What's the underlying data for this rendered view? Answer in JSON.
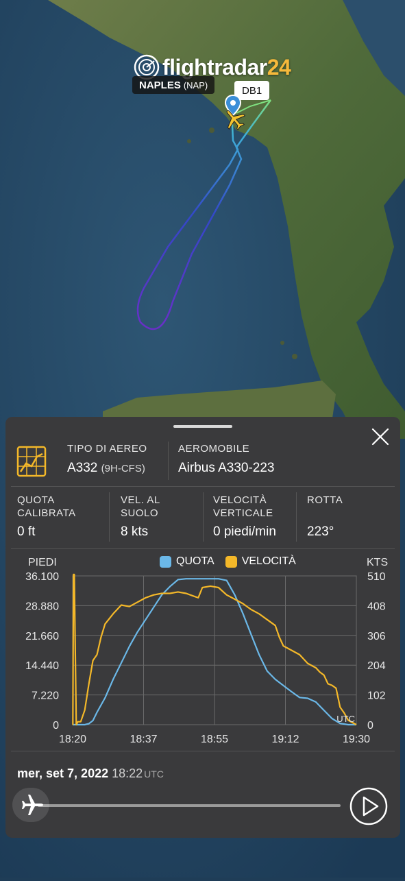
{
  "map": {
    "logo_text_main": "flightradar",
    "logo_text_accent": "24",
    "airport_name": "NAPLES",
    "airport_code": "(NAP)",
    "flight_label": "DB1"
  },
  "panel": {
    "aircraft_type_label": "TIPO DI AEREO",
    "aircraft_type_value": "A332",
    "aircraft_reg": "(9H-CFS)",
    "aircraft_label": "AEROMOBILE",
    "aircraft_value": "Airbus A330-223",
    "altitude_label": "QUOTA CALIBRATA",
    "altitude_value": "0 ft",
    "ground_speed_label": "VEL. AL SUOLO",
    "ground_speed_value": "8 kts",
    "vertical_speed_label": "VELOCITÀ VERTICALE",
    "vertical_speed_value": "0 piedi/min",
    "track_label": "ROTTA",
    "track_value": "223°",
    "date_text": "mer, set 7, 2022",
    "time_text": "18:22",
    "time_zone": "UTC"
  },
  "chart_data": {
    "type": "line",
    "left_axis_title": "PIEDI",
    "right_axis_title": "KTS",
    "utc_label": "UTC",
    "x_tick_labels": [
      "18:20",
      "18:37",
      "18:55",
      "19:12",
      "19:30"
    ],
    "y_left_tick_labels": [
      "0",
      "7.220",
      "14.440",
      "21.660",
      "28.880",
      "36.100"
    ],
    "y_right_tick_labels": [
      "0",
      "102",
      "204",
      "306",
      "408",
      "510"
    ],
    "ylim_left": [
      0,
      36100
    ],
    "ylim_right": [
      0,
      510
    ],
    "xlim_minutes": [
      0,
      70
    ],
    "grid": true,
    "cursor_minute": 0,
    "series": [
      {
        "name": "QUOTA",
        "color": "#6bb8e8",
        "axis": "left",
        "x": [
          0,
          2,
          3,
          4,
          5,
          6,
          8,
          10,
          12,
          14,
          16,
          18,
          20,
          22,
          24,
          26,
          28,
          30,
          32,
          34,
          36,
          38,
          40,
          42,
          44,
          46,
          48,
          50,
          52,
          54,
          56,
          58,
          60,
          62,
          64,
          66,
          68,
          70
        ],
        "y": [
          0,
          0,
          0,
          250,
          1000,
          3000,
          6500,
          11000,
          15000,
          19000,
          22500,
          25500,
          28500,
          31500,
          33500,
          35200,
          35400,
          35400,
          35400,
          35400,
          35400,
          35000,
          31500,
          27000,
          22000,
          17000,
          13000,
          11000,
          9500,
          8000,
          6600,
          6400,
          5500,
          3500,
          1500,
          300,
          0,
          0
        ]
      },
      {
        "name": "VELOCITÀ",
        "color": "#f4b829",
        "axis": "right",
        "x": [
          0,
          0.05,
          0.2,
          0.4,
          0.9,
          1.3,
          2,
          3,
          4,
          5,
          6,
          7,
          8,
          10,
          12,
          14,
          16,
          18,
          20,
          22,
          24,
          26,
          28,
          30,
          31,
          32,
          34,
          36,
          38,
          40,
          42,
          44,
          46,
          48,
          50,
          51,
          52,
          54,
          56,
          58,
          60,
          61,
          62,
          63,
          64,
          65,
          66,
          67,
          68,
          70
        ],
        "y": [
          0,
          0,
          515,
          515,
          0,
          10,
          10,
          50,
          140,
          220,
          240,
          300,
          345,
          380,
          410,
          405,
          420,
          435,
          445,
          450,
          450,
          455,
          450,
          440,
          435,
          470,
          475,
          470,
          445,
          430,
          415,
          395,
          380,
          360,
          340,
          300,
          270,
          255,
          240,
          210,
          195,
          180,
          170,
          140,
          135,
          125,
          60,
          40,
          15,
          0
        ]
      }
    ]
  },
  "colors": {
    "panel_bg": "#3a3a3c",
    "altitude": "#6bb8e8",
    "speed": "#f4b829",
    "track_start": "#7fe07f",
    "track_end": "#6a2ec8"
  },
  "icons": {
    "logo": "flightradar-radar-icon",
    "pin": "airport-pin-icon",
    "plane": "airplane-icon",
    "chart": "chart-graph-icon",
    "close": "close-icon",
    "play": "play-icon"
  }
}
